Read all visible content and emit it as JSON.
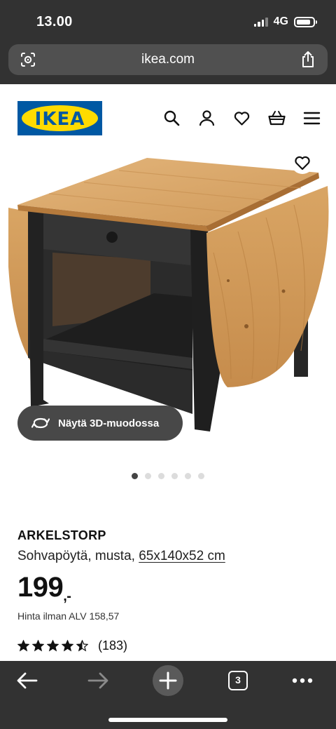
{
  "status_bar": {
    "time": "13.00",
    "network": "4G",
    "battery_level": 0.85
  },
  "browser": {
    "url": "ikea.com",
    "tab_count": "3"
  },
  "header": {
    "logo_text": "IKEA",
    "brand_blue": "#0058a3",
    "brand_yellow": "#ffdb00"
  },
  "gallery": {
    "view3d_label": "Näytä 3D-muodossa",
    "image_count": 6,
    "active_index": 0
  },
  "product": {
    "name": "ARKELSTORP",
    "description": "Sohvapöytä, musta,",
    "dimensions": "65x140x52 cm",
    "price": "199",
    "price_suffix": ",-",
    "price_vat": "Hinta ilman ALV 158,57",
    "rating": 4.5,
    "review_count": "(183)"
  }
}
